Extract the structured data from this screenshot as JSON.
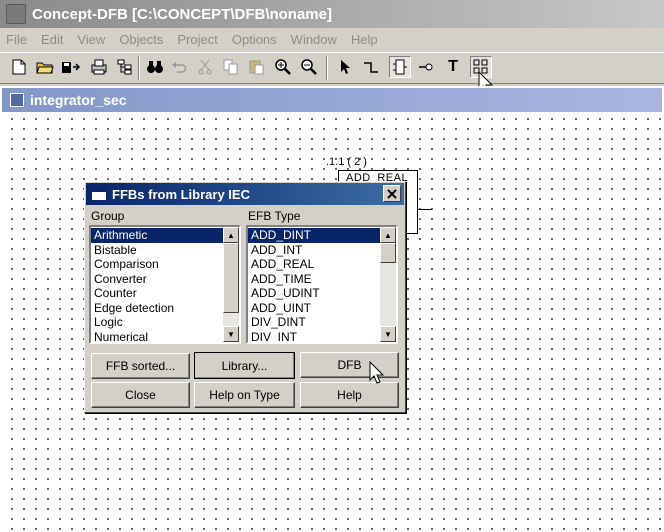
{
  "app": {
    "title": "Concept-DFB [C:\\CONCEPT\\DFB\\noname]"
  },
  "menu": [
    "File",
    "Edit",
    "View",
    "Objects",
    "Project",
    "Options",
    "Window",
    "Help"
  ],
  "toolbar": {
    "tools": [
      "new-file-icon",
      "open-folder-icon",
      "save-icon",
      "print-icon",
      "tree-icon",
      "binoculars-icon",
      "undo-icon",
      "cut-icon",
      "copy-icon",
      "paste-icon",
      "zoom-in-icon",
      "zoom-out-icon",
      "select-pointer-icon",
      "link-icon",
      "ffb-icon",
      "pin-icon",
      "text-icon",
      "ffb-library-icon"
    ]
  },
  "subwindow": {
    "title": "integrator_sec"
  },
  "block": {
    "instance": ".1.1 ( 2 )",
    "type": "ADD_REAL"
  },
  "dialog": {
    "title": "FFBs from Library IEC",
    "group_label": "Group",
    "efb_label": "EFB Type",
    "groups": [
      "Arithmetic",
      "Bistable",
      "Comparison",
      "Converter",
      "Counter",
      "Edge detection",
      "Logic",
      "Numerical"
    ],
    "efb_types": [
      "ADD_DINT",
      "ADD_INT",
      "ADD_REAL",
      "ADD_TIME",
      "ADD_UDINT",
      "ADD_UINT",
      "DIV_DINT",
      "DIV_INT"
    ],
    "buttons": {
      "ffb_sorted": "FFB sorted...",
      "library": "Library...",
      "dfb": "DFB",
      "close": "Close",
      "help_on_type": "Help on Type",
      "help": "Help"
    }
  },
  "colors": {
    "selection": "#0a246a",
    "dialog_title": "#0a246a",
    "subwindow_title": "#8397c8"
  }
}
